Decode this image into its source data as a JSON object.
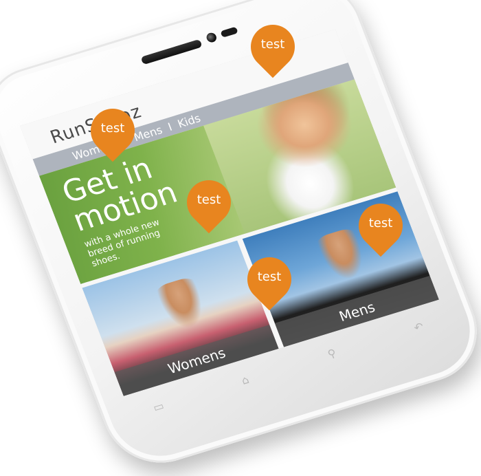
{
  "app": {
    "brand": "RunShooz"
  },
  "nav": {
    "items": [
      "Womens",
      "Mens",
      "Kids"
    ],
    "separator": "I"
  },
  "hero": {
    "title": "Get in motion",
    "subtitle": "with a whole new breed of running shoes."
  },
  "tiles": [
    {
      "label": "Womens"
    },
    {
      "label": "Mens"
    }
  ],
  "softkeys": {
    "home": "⌂",
    "search": "⚲",
    "back": "↶",
    "menu": "▭"
  },
  "pins": [
    {
      "label": "test"
    },
    {
      "label": "test"
    },
    {
      "label": "test"
    },
    {
      "label": "test"
    },
    {
      "label": "test"
    }
  ],
  "colors": {
    "pin": "#e8851f",
    "nav_bar": "#aeb4bd",
    "hero_green": "#7fb24b"
  }
}
